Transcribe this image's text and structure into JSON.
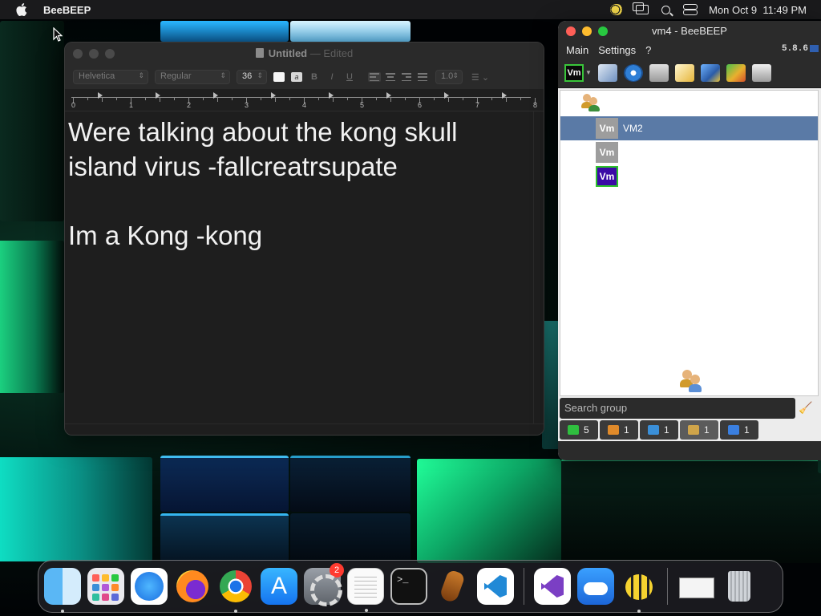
{
  "menubar": {
    "app_name": "BeeBEEP",
    "clock": "Mon Oct 9  11:49 PM",
    "icons": [
      "apple-icon",
      "beebeep-status-icon",
      "screen-mirroring-icon",
      "spotlight-search-icon",
      "control-center-icon"
    ]
  },
  "textedit": {
    "title": "Untitled",
    "title_sep": "—",
    "title_status": "Edited",
    "font_family": "Helvetica",
    "font_style": "Regular",
    "font_size": "36",
    "fmt_bold": "B",
    "fmt_italic": "I",
    "fmt_underline": "U",
    "line_spacing": "1.0",
    "ruler_numbers": [
      "0",
      "1",
      "2",
      "3",
      "4",
      "5",
      "6",
      "7",
      "8"
    ],
    "document_text": "Were talking about the kong skull\nisland virus -fallcreatrsupate\n\nIm a Kong -kong"
  },
  "beebeep": {
    "title": "vm4 - BeeBEEP",
    "menu": {
      "main": "Main",
      "settings": "Settings",
      "help": "?"
    },
    "version": "5.8.6",
    "toolbar_vm_label": "Vm",
    "toolbar_icons": [
      "status-vm-icon",
      "profile-edit-icon",
      "network-icon",
      "message-box-icon",
      "compose-icon",
      "plugins-icon",
      "file-transfer-icon",
      "screenshot-icon"
    ],
    "users": [
      {
        "badge": "Vm",
        "name": "VM2",
        "selected": true
      },
      {
        "badge": "Vm",
        "name": "",
        "selected": false
      },
      {
        "badge": "Vm",
        "name": "",
        "selected": false
      }
    ],
    "search_placeholder": "Search group",
    "status_tabs": [
      {
        "icon": "users-online-icon",
        "count": "5",
        "color": "#2fbf3f"
      },
      {
        "icon": "groups-icon",
        "count": "1",
        "color": "#e08a2a"
      },
      {
        "icon": "chats-icon",
        "count": "1",
        "color": "#3a8fd8"
      },
      {
        "icon": "group-members-icon",
        "count": "1",
        "color": "#d0a54a"
      },
      {
        "icon": "shares-icon",
        "count": "1",
        "color": "#3a7fe0"
      }
    ]
  },
  "dock": {
    "apps": [
      {
        "name": "Finder",
        "running": true
      },
      {
        "name": "Launchpad",
        "running": false
      },
      {
        "name": "Safari",
        "running": false
      },
      {
        "name": "Firefox",
        "running": false
      },
      {
        "name": "Google Chrome",
        "running": true
      },
      {
        "name": "App Store",
        "running": false
      },
      {
        "name": "System Settings",
        "running": false,
        "badge": "2"
      },
      {
        "name": "TextEdit",
        "running": true
      },
      {
        "name": "Terminal",
        "running": false
      },
      {
        "name": "GarageBand",
        "running": false
      },
      {
        "name": "Visual Studio Code",
        "running": false
      },
      {
        "name": "Visual Studio",
        "running": false
      },
      {
        "name": "Weather",
        "running": false
      },
      {
        "name": "BeeBEEP",
        "running": true
      },
      {
        "name": "Screen Window",
        "running": false
      },
      {
        "name": "Trash",
        "running": false
      }
    ]
  },
  "colors": {
    "selection_row": "#5a7aa6",
    "vm_badge_purple": "#3a0aa6",
    "vm_badge_border": "#2ec22b",
    "traffic_red": "#ff5f57",
    "traffic_yellow": "#febc2e",
    "traffic_green": "#28c840"
  }
}
